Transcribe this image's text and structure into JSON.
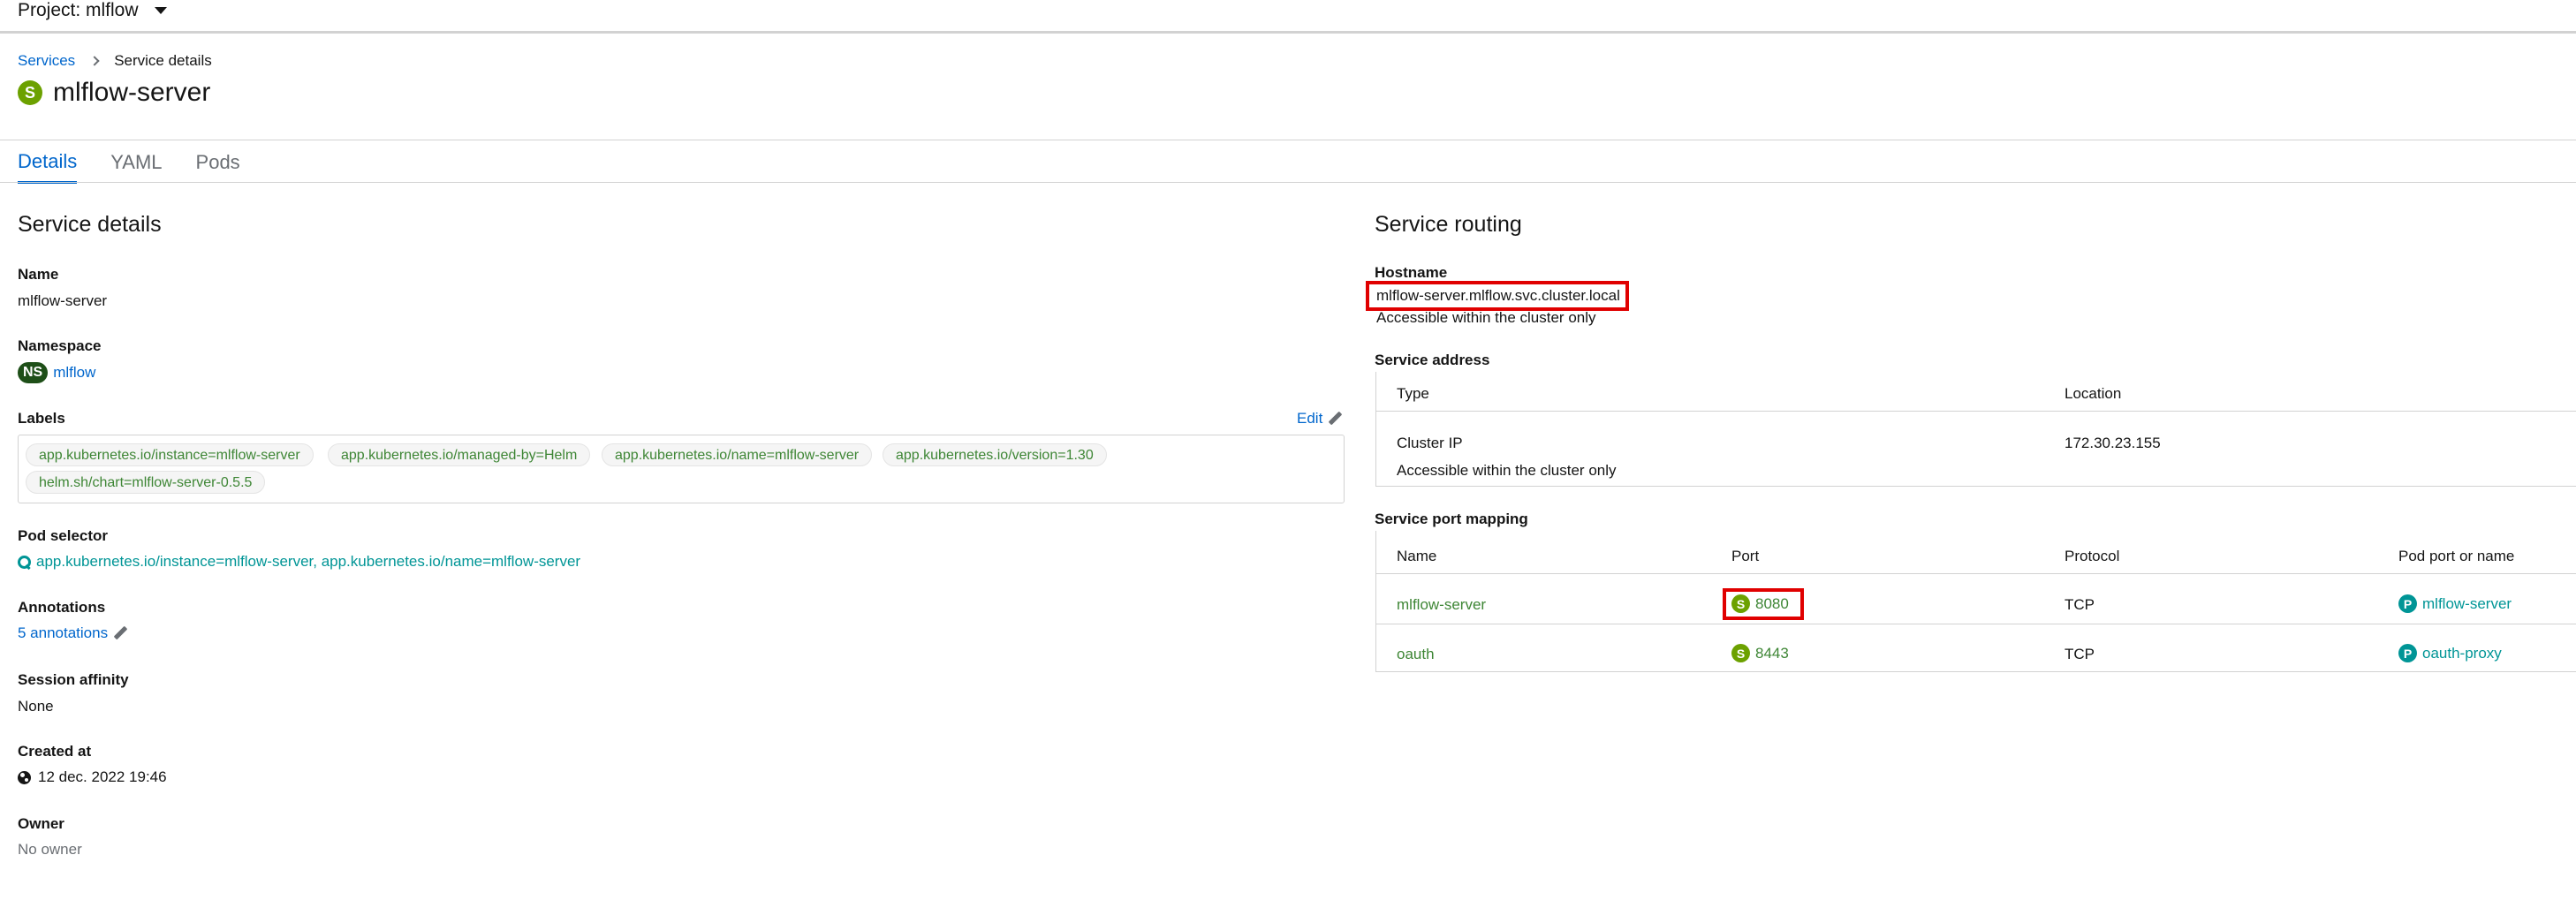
{
  "header": {
    "project_label": "Project: mlflow"
  },
  "breadcrumb": {
    "parent": "Services",
    "current": "Service details"
  },
  "page": {
    "badge": "S",
    "title": "mlflow-server"
  },
  "tabs": [
    {
      "label": "Details",
      "active": true
    },
    {
      "label": "YAML",
      "active": false
    },
    {
      "label": "Pods",
      "active": false
    }
  ],
  "service_details": {
    "title": "Service details",
    "name_label": "Name",
    "name_value": "mlflow-server",
    "namespace_label": "Namespace",
    "namespace_badge": "NS",
    "namespace_value": "mlflow",
    "labels_label": "Labels",
    "labels_edit": "Edit",
    "labels": [
      "app.kubernetes.io/instance=mlflow-server",
      "app.kubernetes.io/managed-by=Helm",
      "app.kubernetes.io/name=mlflow-server",
      "app.kubernetes.io/version=1.30",
      "helm.sh/chart=mlflow-server-0.5.5"
    ],
    "pod_selector_label": "Pod selector",
    "pod_selector_value": "app.kubernetes.io/instance=mlflow-server, app.kubernetes.io/name=mlflow-server",
    "annotations_label": "Annotations",
    "annotations_value": "5 annotations",
    "session_affinity_label": "Session affinity",
    "session_affinity_value": "None",
    "created_at_label": "Created at",
    "created_at_value": "12 dec. 2022 19:46",
    "owner_label": "Owner",
    "owner_value": "No owner"
  },
  "service_routing": {
    "title": "Service routing",
    "hostname_label": "Hostname",
    "hostname_value": "mlflow-server.mlflow.svc.cluster.local",
    "hostname_note": "Accessible within the cluster only",
    "address_label": "Service address",
    "address_columns": [
      "Type",
      "Location"
    ],
    "address_row": {
      "type": "Cluster IP",
      "note": "Accessible within the cluster only",
      "location": "172.30.23.155"
    },
    "port_mapping_label": "Service port mapping",
    "port_columns": [
      "Name",
      "Port",
      "Protocol",
      "Pod port or name"
    ],
    "ports": [
      {
        "name": "mlflow-server",
        "badge": "S",
        "port": "8080",
        "protocol": "TCP",
        "pod_badge": "P",
        "pod_port": "mlflow-server"
      },
      {
        "name": "oauth",
        "badge": "S",
        "port": "8443",
        "protocol": "TCP",
        "pod_badge": "P",
        "pod_port": "oauth-proxy"
      }
    ]
  },
  "colors": {
    "link": "#0066cc",
    "label_green": "#3e8635",
    "service_badge": "#6ca100",
    "pod_badge": "#009596",
    "namespace_badge": "#1e4f18",
    "highlight": "#e00000"
  }
}
